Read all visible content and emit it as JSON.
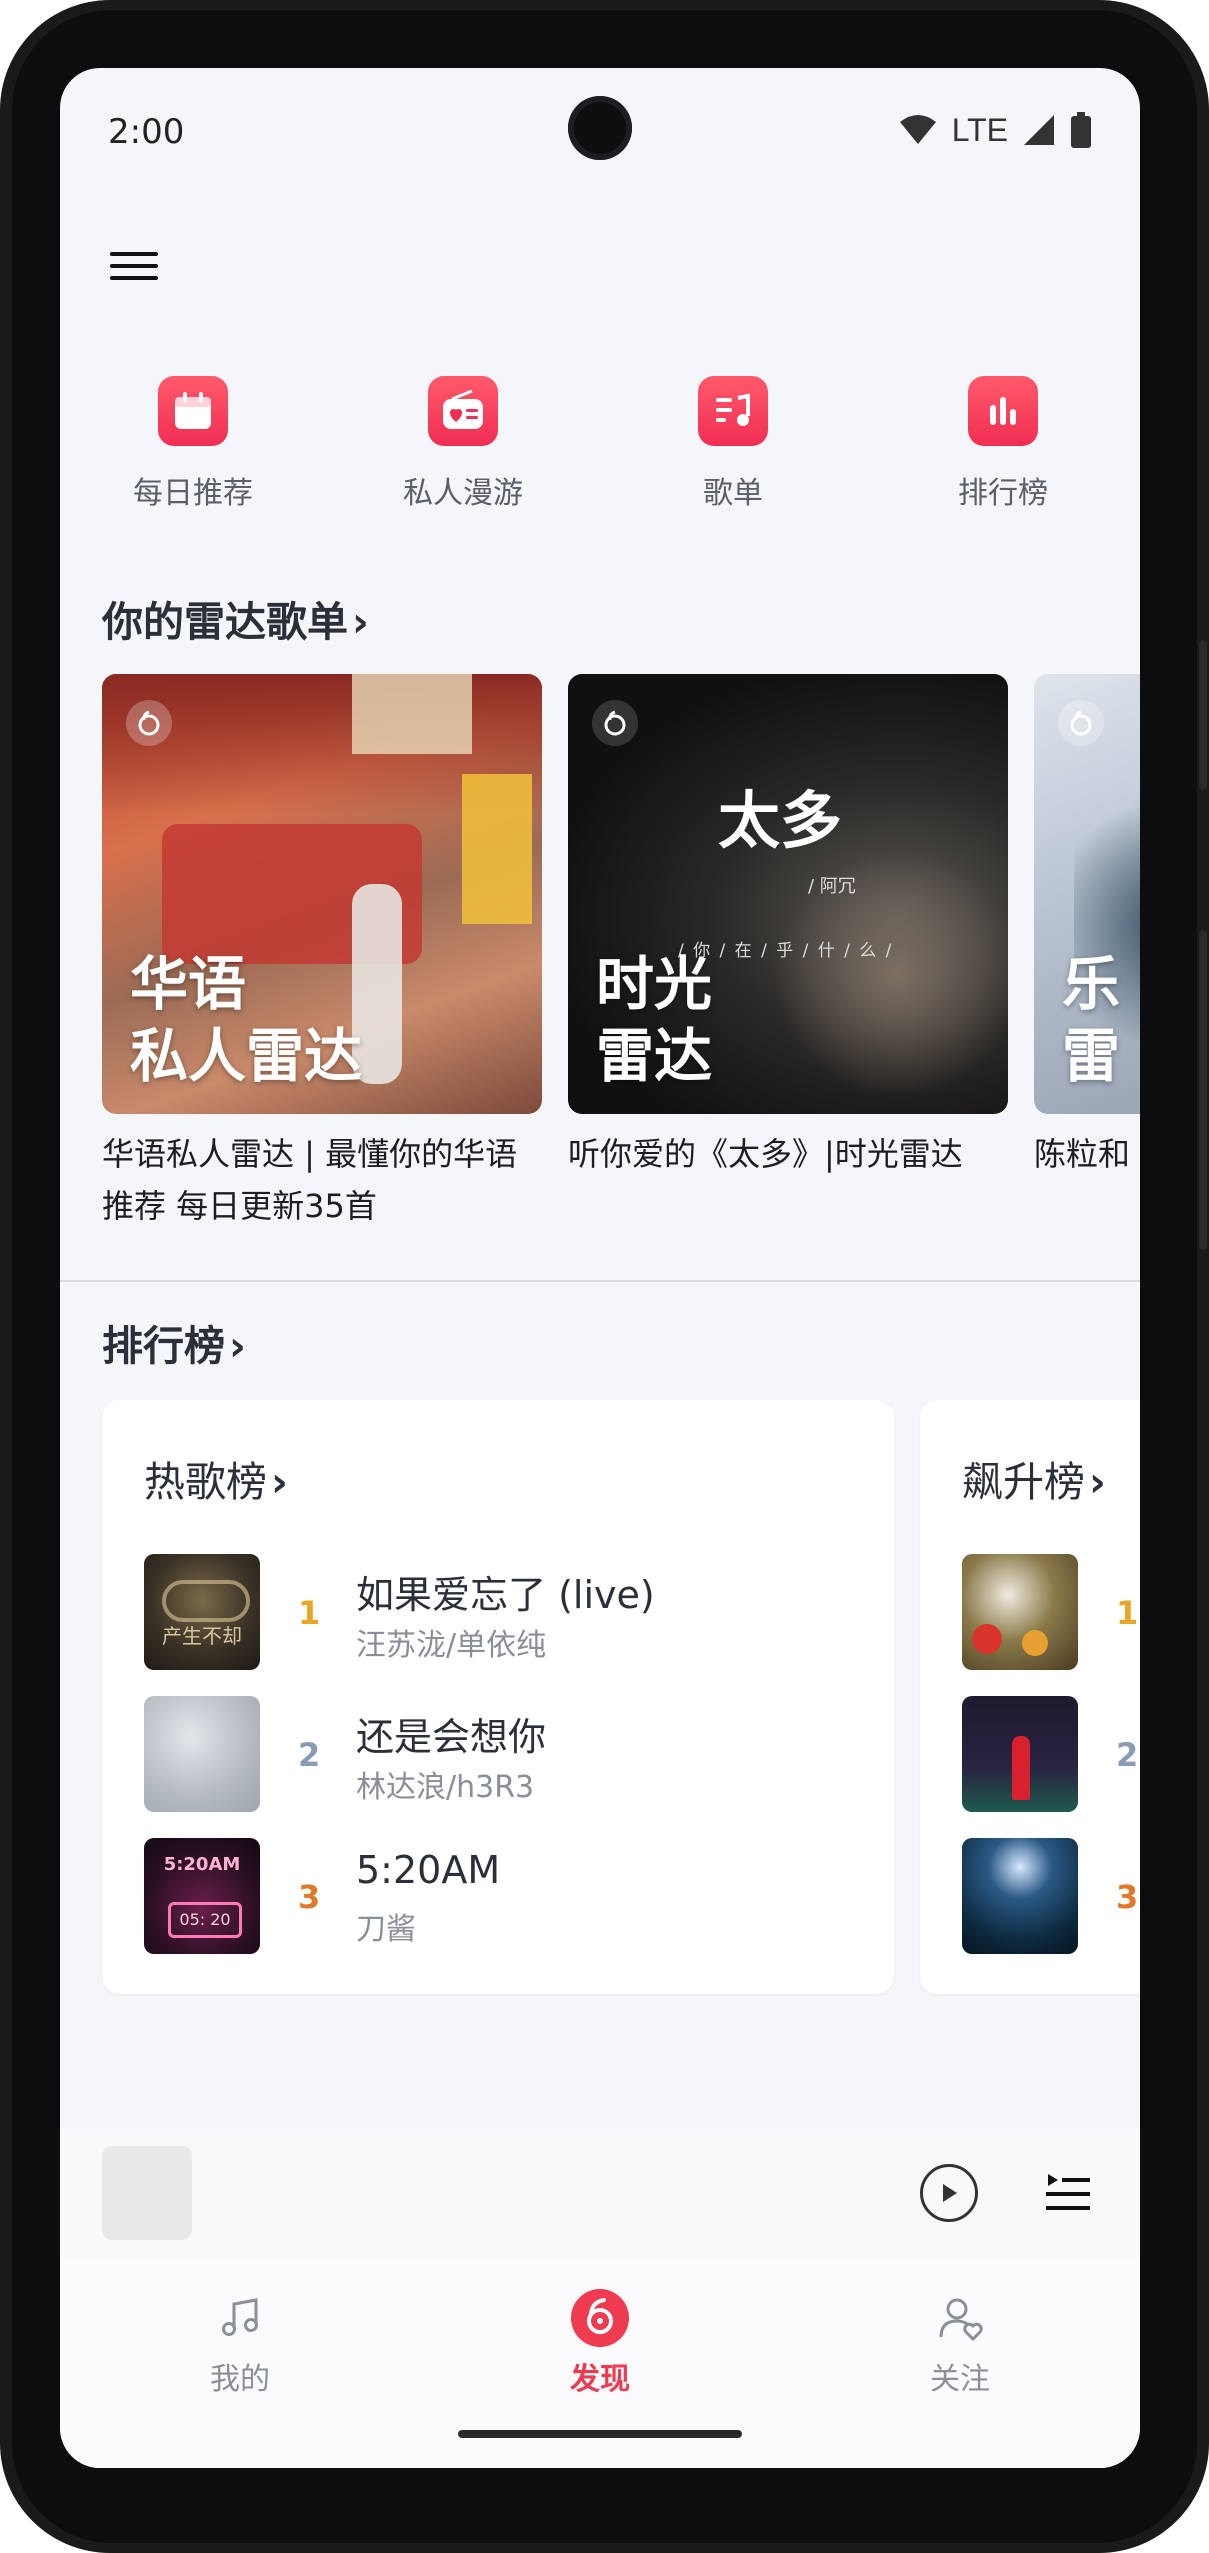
{
  "status_bar": {
    "time": "2:00",
    "network": "LTE"
  },
  "shortcuts": [
    {
      "label": "每日推荐",
      "icon": "calendar-icon"
    },
    {
      "label": "私人漫游",
      "icon": "radio-icon"
    },
    {
      "label": "歌单",
      "icon": "playlist-icon"
    },
    {
      "label": "排行榜",
      "icon": "chart-icon"
    }
  ],
  "radar": {
    "title": "你的雷达歌单",
    "cards": [
      {
        "overlay_line1": "华语",
        "overlay_line2": "私人雷达",
        "description": "华语私人雷达 | 最懂你的华语推荐 每日更新35首"
      },
      {
        "overlay_line1": "时光",
        "overlay_line2": "雷达",
        "art_title": "太多",
        "art_sub": "/ 阿冗",
        "art_line": "/ 你 / 在 / 乎 / 什 / 么 /",
        "description": "听你爱的《太多》|时光雷达"
      },
      {
        "overlay_line1": "乐",
        "overlay_line2": "雷",
        "description": "陈粒和"
      }
    ]
  },
  "charts": {
    "title": "排行榜",
    "boards": [
      {
        "title": "热歌榜",
        "songs": [
          {
            "rank": "1",
            "title": "如果爱忘了 (live)",
            "artist": "汪苏泷/单依纯"
          },
          {
            "rank": "2",
            "title": "还是会想你",
            "artist": "林达浪/h3R3"
          },
          {
            "rank": "3",
            "title": "5:20AM",
            "artist": "刀酱"
          }
        ]
      },
      {
        "title": "飙升榜",
        "songs": [
          {
            "rank": "1"
          },
          {
            "rank": "2"
          },
          {
            "rank": "3"
          }
        ]
      }
    ]
  },
  "tabs": [
    {
      "label": "我的",
      "icon": "music-note-icon"
    },
    {
      "label": "发现",
      "icon": "netease-logo-icon",
      "active": true
    },
    {
      "label": "关注",
      "icon": "user-follow-icon"
    }
  ],
  "colors": {
    "accent": "#ef3b4f",
    "rank1": "#e8a623",
    "rank2": "#8a9bb5",
    "rank3": "#e07a2a"
  }
}
